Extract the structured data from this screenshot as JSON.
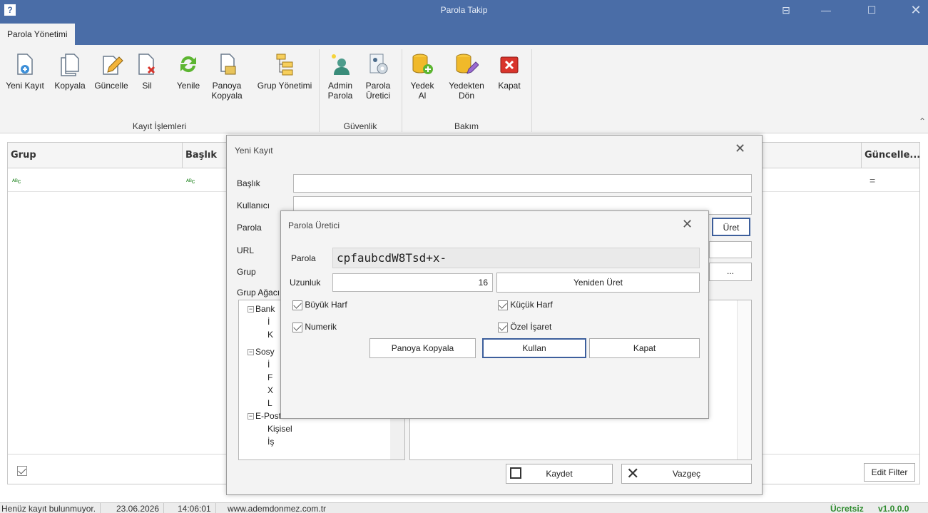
{
  "window": {
    "title": "Parola Takip",
    "help_icon": "?"
  },
  "tabs": [
    {
      "label": "Parola Yönetimi"
    }
  ],
  "ribbon": {
    "groups": [
      {
        "label": "Kayıt İşlemleri"
      },
      {
        "label": "Güvenlik"
      },
      {
        "label": "Bakım"
      }
    ],
    "buttons": {
      "new": {
        "line1": "Yeni Kayıt",
        "line2": ""
      },
      "copy": {
        "line1": "Kopyala",
        "line2": ""
      },
      "update": {
        "line1": "Güncelle",
        "line2": ""
      },
      "delete": {
        "line1": "Sil",
        "line2": ""
      },
      "refresh": {
        "line1": "Yenile",
        "line2": ""
      },
      "clipboard": {
        "line1": "Panoya",
        "line2": "Kopyala"
      },
      "group": {
        "line1": "Grup Yönetimi",
        "line2": ""
      },
      "admin": {
        "line1": "Admin",
        "line2": "Parola"
      },
      "generator": {
        "line1": "Parola",
        "line2": "Üretici"
      },
      "backup": {
        "line1": "Yedek",
        "line2": "Al"
      },
      "restore": {
        "line1": "Yedekten",
        "line2": "Dön"
      },
      "close": {
        "line1": "Kapat",
        "line2": ""
      }
    }
  },
  "grid": {
    "columns": [
      "Grup",
      "Başlık",
      "Güncelle..."
    ],
    "filter_glyph": "ᴬᴮc",
    "filter_equals": "=",
    "edit_filter": "Edit Filter"
  },
  "status": {
    "message": "Henüz kayıt bulunmuyor.",
    "date": "23.06.2026",
    "time": "14:06:01",
    "site": "www.ademdonmez.com.tr",
    "license": "Ücretsiz",
    "version": "v1.0.0.0",
    "license_color": "#2e8b2e"
  },
  "new_record": {
    "title": "Yeni Kayıt",
    "fields": {
      "title": "Başlık",
      "user": "Kullanıcı",
      "password": "Parola",
      "url": "URL",
      "group": "Grup",
      "group_tree": "Grup Ağacı"
    },
    "generate_btn": "Üret",
    "browse_btn": "...",
    "save_btn": "Kaydet",
    "cancel_btn": "Vazgeç",
    "tree": [
      {
        "label": "Bank",
        "children": [
          "İ",
          "K"
        ]
      },
      {
        "label": "Sosy",
        "children": [
          "İ",
          "F",
          "X",
          "L"
        ]
      },
      {
        "label": "E-Posta",
        "children": [
          "Kişisel",
          "İş"
        ]
      }
    ]
  },
  "generator": {
    "title": "Parola Üretici",
    "password_label": "Parola",
    "password_value": "cpfaubcdW8Tsd+x-",
    "length_label": "Uzunluk",
    "length_value": "16",
    "regenerate": "Yeniden Üret",
    "options": {
      "upper": "Büyük Harf",
      "lower": "Küçük Harf",
      "numeric": "Numerik",
      "special": "Özel İşaret"
    },
    "copy_btn": "Panoya Kopyala",
    "use_btn": "Kullan",
    "close_btn": "Kapat"
  }
}
